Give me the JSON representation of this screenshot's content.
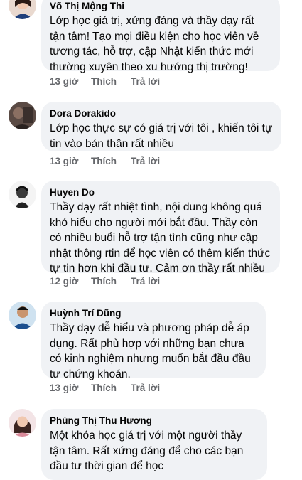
{
  "comments": [
    {
      "author": "Võ Thị Mộng Thi",
      "text": "Lớp học giá trị, xứng đáng và thầy dạy rất tận tâm! Tạo mọi điều kiện cho học viên về tương tác, hỗ trợ, cập Nhật kiến thức mới thường xuyên theo xu hướng thị trường!",
      "time": "13 giờ",
      "like_label": "Thích",
      "reply_label": "Trả lời"
    },
    {
      "author": "Dora Dorakido",
      "text": "Lớp học thực sự có giá trị với tôi , khiến tôi tự tin vào bản thân rất nhiều",
      "time": "13 giờ",
      "like_label": "Thích",
      "reply_label": "Trả lời"
    },
    {
      "author": "Huyen Do",
      "text": "Thầy dạy rất nhiệt tình, nội dung không quá khó hiểu cho người mới bắt đầu. Thầy còn có nhiều buổi hỗ trợ tận tình cũng như cập nhật thông rtin để học viên có thêm kiến thức tự tin hơn khi đầu tư. Cảm ơn thầy rất nhiều",
      "time": "12 giờ",
      "like_label": "Thích",
      "reply_label": "Trả lời"
    },
    {
      "author": "Huỳnh Trí Dũng",
      "text": "Thầy dạy dễ hiểu và phương pháp dễ áp dụng. Rất phù hợp với những bạn chưa có kinh nghiệm nhưng muốn bắt đầu đầu tư chứng khoán.",
      "time": "13 giờ",
      "like_label": "Thích",
      "reply_label": "Trả lời"
    },
    {
      "author": "Phùng Thị Thu Hương",
      "text": "Một khóa học giá trị với một người thầy tận tâm. Rất xứng đáng để cho các bạn đầu tư thời gian để học",
      "time": "",
      "like_label": "",
      "reply_label": ""
    }
  ]
}
